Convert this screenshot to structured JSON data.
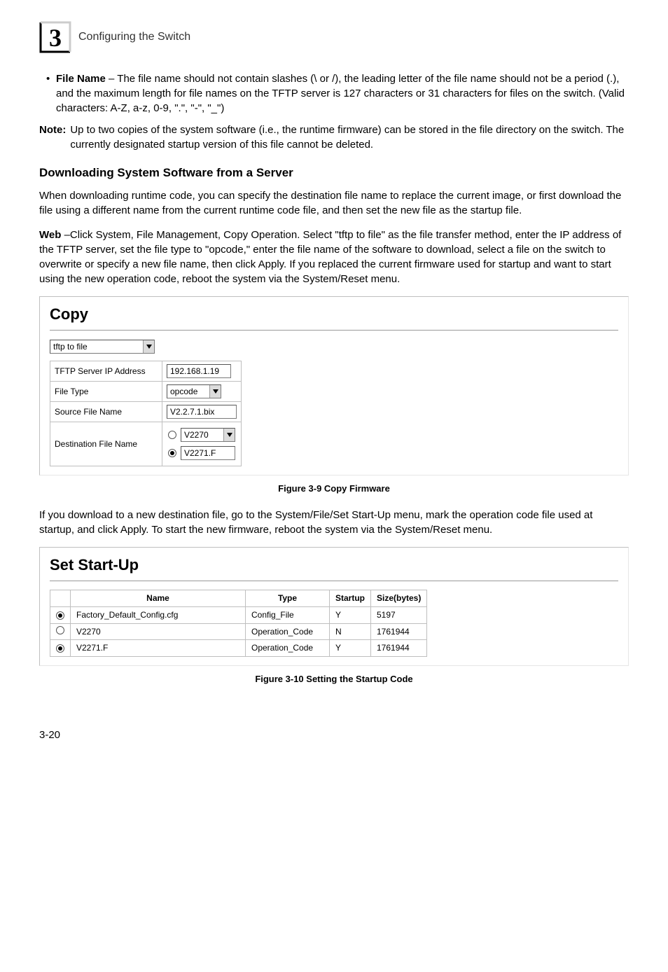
{
  "header": {
    "chapter_number": "3",
    "section_title": "Configuring the Switch"
  },
  "content": {
    "file_name_bullet": {
      "label": "File Name",
      "text": " – The file name should not contain slashes (\\ or /), the leading letter of the file name should not be a period (.), and the maximum length for file names on the TFTP server is 127 characters or 31 characters for files on the switch. (Valid characters: A-Z, a-z, 0-9, \".\", \"-\", \"_\")"
    },
    "note": {
      "label": "Note:",
      "text": "Up to two copies of the system software (i.e., the runtime firmware) can be stored in the file directory on the switch. The currently designated startup version of this file cannot be deleted."
    },
    "subheading": "Downloading System Software from a Server",
    "para1": "When downloading runtime code, you can specify the destination file name to replace the current image, or first download the file using a different name from the current runtime code file, and then set the new file as the startup file.",
    "para2_prefix": "Web",
    "para2_rest": " –Click System, File Management, Copy Operation. Select \"tftp to file\" as the file transfer method, enter the IP address of the TFTP server, set the file type to \"opcode,\" enter the file name of the software to download, select a file on the switch to overwrite or specify a new file name, then click Apply. If you replaced the current firmware used for startup and want to start using the new operation code, reboot the system via the System/Reset menu.",
    "para3": "If you download to a new destination file, go to the System/File/Set Start-Up menu, mark the operation code file used at startup, and click Apply. To start the new firmware, reboot the system via the System/Reset menu."
  },
  "copy_panel": {
    "title": "Copy",
    "method_select": "tftp to file",
    "rows": {
      "ip_label": "TFTP Server IP Address",
      "ip_value": "192.168.1.19",
      "filetype_label": "File Type",
      "filetype_value": "opcode",
      "source_label": "Source File Name",
      "source_value": "V2.2.7.1.bix",
      "dest_label": "Destination File Name",
      "dest_opt1": "V2270",
      "dest_opt2": "V2271.F"
    }
  },
  "fig1_caption": "Figure 3-9  Copy Firmware",
  "startup_panel": {
    "title": "Set Start-Up",
    "columns": {
      "name": "Name",
      "type": "Type",
      "startup": "Startup",
      "size": "Size(bytes)"
    },
    "rows": [
      {
        "selected": true,
        "name": "Factory_Default_Config.cfg",
        "type": "Config_File",
        "startup": "Y",
        "size": "5197"
      },
      {
        "selected": false,
        "name": "V2270",
        "type": "Operation_Code",
        "startup": "N",
        "size": "1761944"
      },
      {
        "selected": true,
        "name": "V2271.F",
        "type": "Operation_Code",
        "startup": "Y",
        "size": "1761944"
      }
    ]
  },
  "fig2_caption": "Figure 3-10  Setting the Startup Code",
  "footer": {
    "page": "3-20"
  }
}
